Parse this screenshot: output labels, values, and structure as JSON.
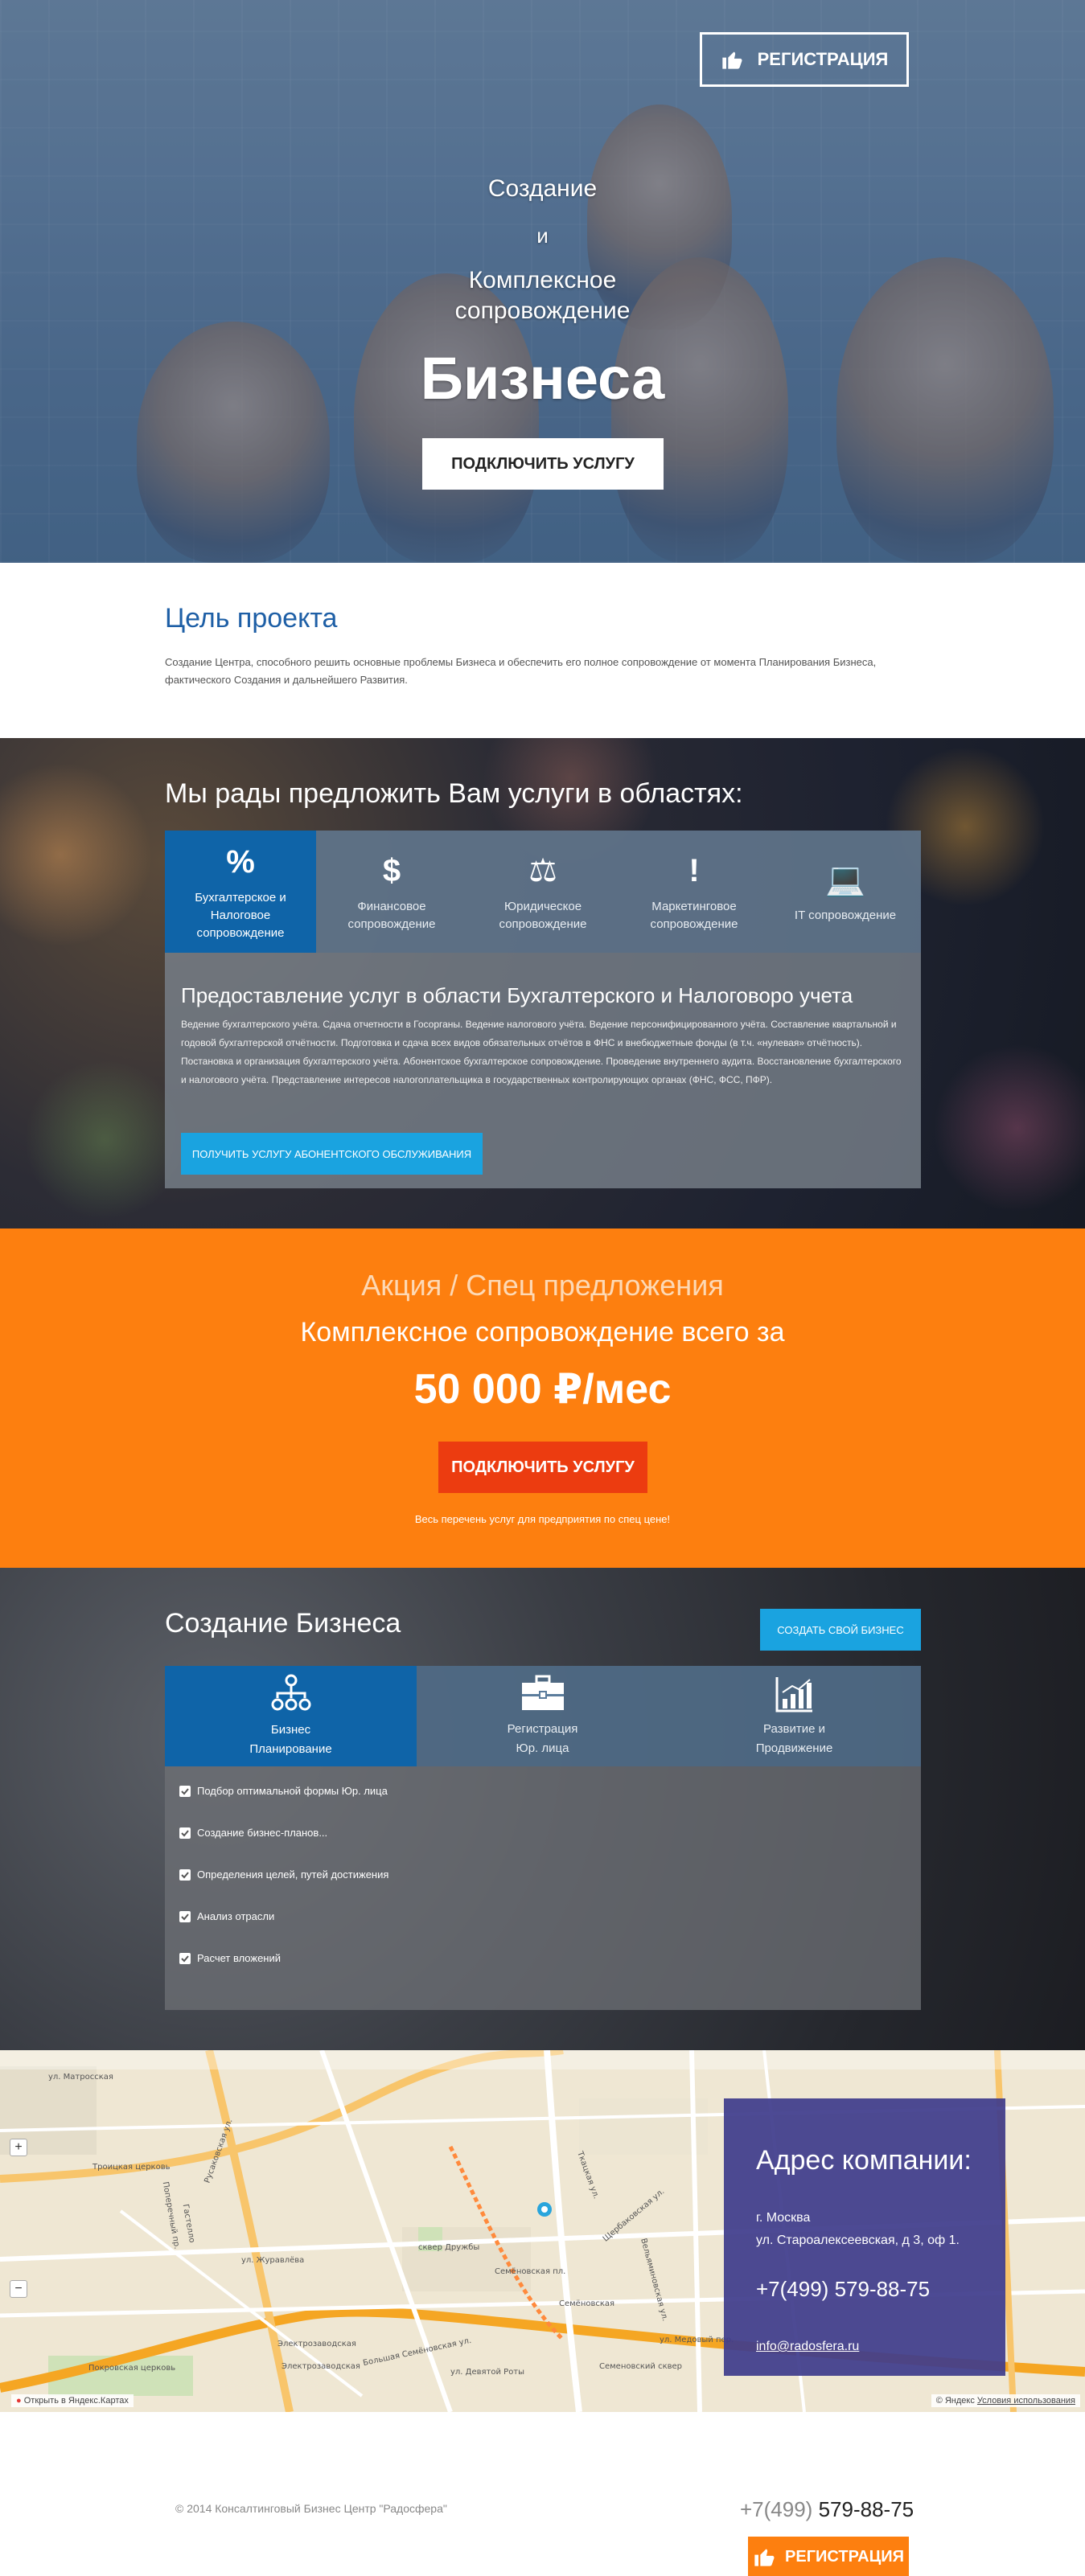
{
  "hero": {
    "register_label": "РЕГИСТРАЦИЯ",
    "line1": "Создание",
    "line2": "и",
    "line3a": "Комплексное",
    "line3b": "сопровождение",
    "big": "Бизнеса",
    "cta": "ПОДКЛЮЧИТЬ УСЛУГУ"
  },
  "goal": {
    "title": "Цель проекта",
    "text": "Создание Центра, способного решить основные проблемы Бизнеса и обеспечить его полное сопровождение от момента Планирования Бизнеса, фактического Создания и дальнейшего Развития."
  },
  "services": {
    "title": "Мы рады предложить Вам услуги в областях:",
    "tabs": [
      {
        "icon": "%",
        "line1": "Бухгалтерское и",
        "line2": "Налоговое",
        "line3": "сопровождение"
      },
      {
        "icon": "$",
        "line1": "Финансовое",
        "line2": "сопровождение",
        "line3": ""
      },
      {
        "icon": "⚖",
        "line1": "Юридическое",
        "line2": "сопровождение",
        "line3": ""
      },
      {
        "icon": "!",
        "line1": "Маркетинговое",
        "line2": "сопровождение",
        "line3": ""
      },
      {
        "icon": "💻",
        "line1": "IT сопровождение",
        "line2": "",
        "line3": ""
      }
    ],
    "panel_title": "Предоставление услуг в области Бухгалтерского и Налоговоро учета",
    "panel_text": "Ведение бухгалтерского учёта. Сдача отчетности в Госорганы. Ведение налогового учёта. Ведение персонифицированного учёта. Составление квартальной и годовой бухгалтерской отчётности. Подготовка и сдача всех видов обязательных отчётов в ФНС и внебюджетные фонды (в т.ч. «нулевая» отчётность). Постановка и организация бухгалтерского учёта. Абонентское бухгалтерское сопровождение. Проведение внутреннего аудита. Восстановление бухгалтерского и налогового учёта. Представление интересов налогоплательщика в государственных контролирующих органах (ФНС, ФСС, ПФР).",
    "button": "ПОЛУЧИТЬ УСЛУГУ АБОНЕНТСКОГО ОБСЛУЖИВАНИЯ"
  },
  "promo": {
    "title": "Акция / Спец предложения",
    "subtitle": "Комплексное сопровождение всего за",
    "price": "50 000 ₽/мес",
    "button": "ПОДКЛЮЧИТЬ УСЛУГУ",
    "note": "Весь перечень услуг для предприятия по спец цене!"
  },
  "business": {
    "title": "Создание Бизнеса",
    "button": "СОЗДАТЬ СВОЙ БИЗНЕС",
    "tabs": [
      {
        "line1": "Бизнес",
        "line2": "Планирование"
      },
      {
        "line1": "Регистрация",
        "line2": "Юр. лица"
      },
      {
        "line1": "Развитие и",
        "line2": "Продвижение"
      }
    ],
    "items": [
      "Подбор оптимальной формы Юр. лица",
      "Создание бизнес-планов...",
      "Определения целей, путей достижения",
      "Анализ отрасли",
      "Расчет вложений"
    ]
  },
  "map": {
    "labels": {
      "l1": "ул. Матросская",
      "l2": "Троицкая церковь",
      "l3": "Русаковская ул.",
      "l4": "Поперечный пр.",
      "l5": "Гастелло",
      "l6": "ул. Журавлёва",
      "l7": "Электрозаводская",
      "l8": "Большая Семёновская ул.",
      "l9": "Семёновская",
      "l10": "Семёновская пл.",
      "l11": "сквер Дружбы",
      "l12": "Щербаковская ул.",
      "l13": "Ткацкая ул.",
      "l14": "Вельяминовская ул.",
      "l15": "Покровская церковь",
      "l16": "Электрозаводская",
      "l17": "ул. Девятой Роты",
      "l18": "ул. Медовый пер.",
      "l19": "Семеновский сквер"
    },
    "open_label": "Открыть в Яндекс.Картах",
    "copyright": "© Яндекс",
    "terms": "Условия использования"
  },
  "address": {
    "title": "Адрес компании:",
    "city": "г. Москва",
    "street": "ул. Староалексеевская, д 3, оф 1.",
    "phone": "+7(499) 579-88-75",
    "email": "info@radosfera.ru"
  },
  "footer": {
    "copyright": "© 2014 Консалтинговый Бизнес Центр \"Радосфера\"",
    "phone_prefix": "+7(499)",
    "phone_number": "579-88-75",
    "register_label": "РЕГИСТРАЦИЯ"
  },
  "colors": {
    "accent_blue": "#1e5fa6",
    "promo_orange": "#fd7f0f",
    "promo_button": "#ec3c10",
    "cta_light_blue": "#1aa3e0",
    "address_purple": "#403c8c"
  }
}
